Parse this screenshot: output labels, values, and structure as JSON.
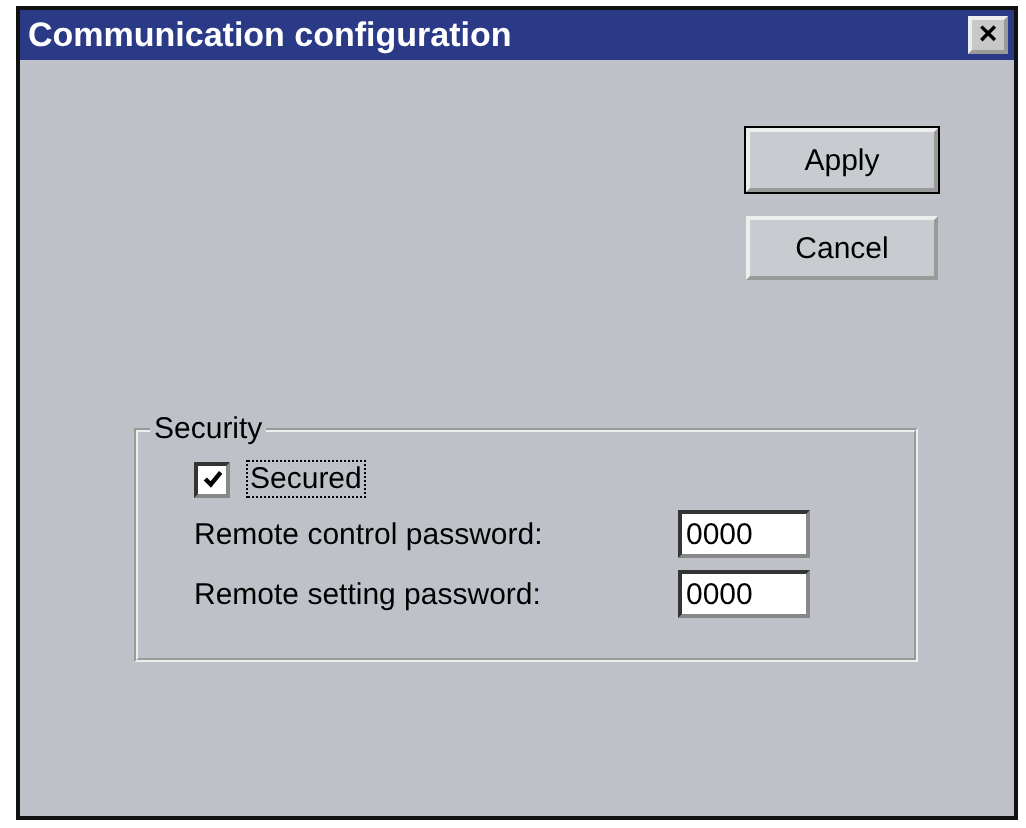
{
  "window": {
    "title": "Communication configuration",
    "close": "×"
  },
  "buttons": [
    {
      "label": "Apply"
    },
    {
      "label": "Cancel"
    }
  ],
  "security": {
    "title": "Security",
    "checkbox": {
      "label": "Secured",
      "checked": true
    },
    "fields": [
      {
        "label": "Remote control password:",
        "value": "0000"
      },
      {
        "label": "Remote setting password:",
        "value": "0000"
      }
    ]
  }
}
